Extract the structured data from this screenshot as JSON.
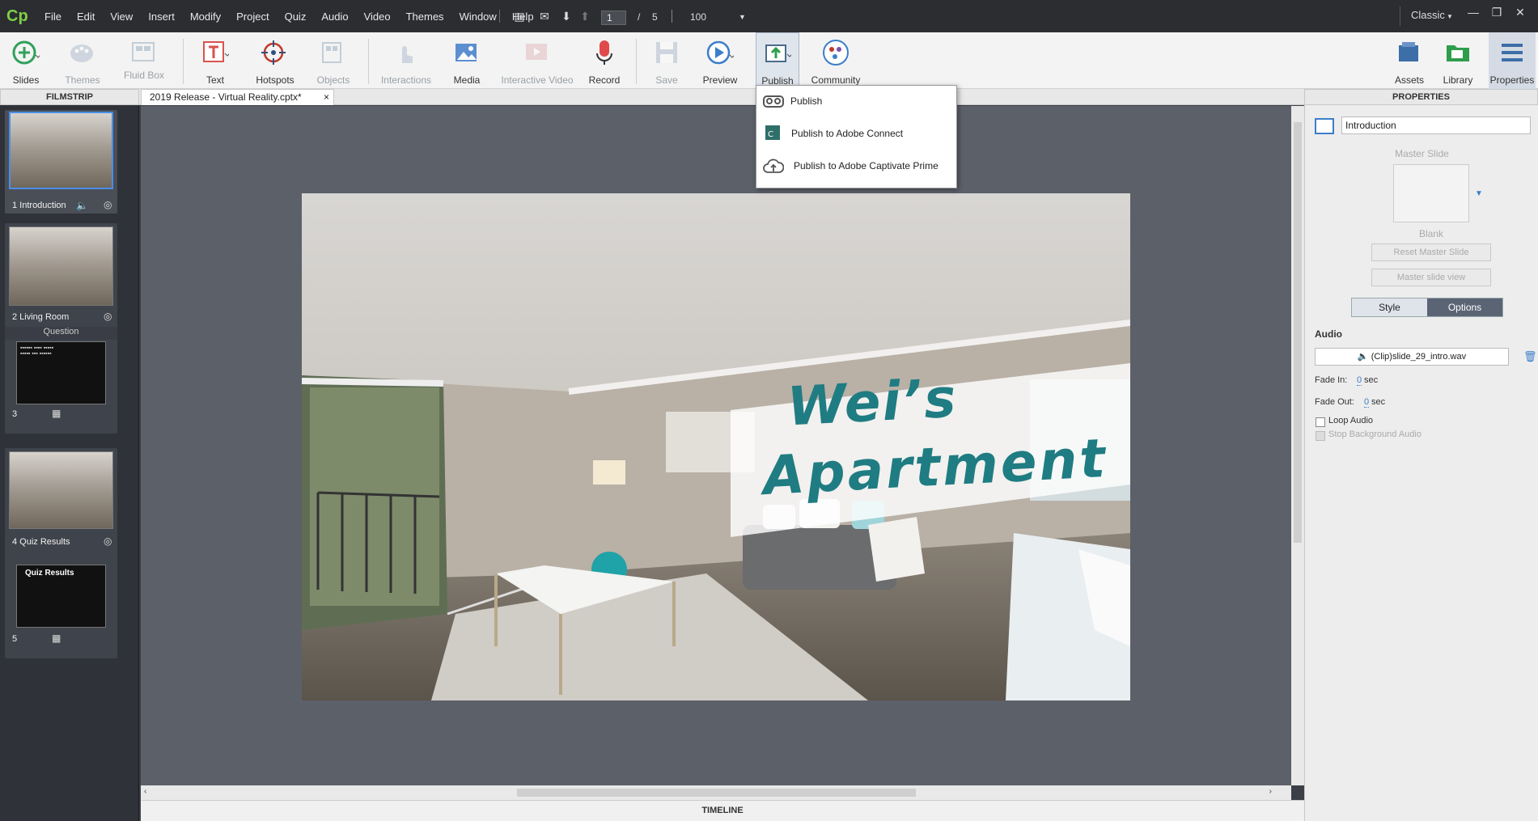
{
  "app": {
    "logo": "Cp"
  },
  "menubar": {
    "items": [
      "File",
      "Edit",
      "View",
      "Insert",
      "Modify",
      "Project",
      "Quiz",
      "Audio",
      "Video",
      "Themes",
      "Window",
      "Help"
    ],
    "current_slide": "1",
    "slide_separator": "/",
    "total_slides": "5",
    "zoom": "100",
    "workspace": "Classic"
  },
  "toolbar": {
    "slides": "Slides",
    "themes": "Themes",
    "fluid_box": "Fluid Box",
    "text": "Text",
    "hotspots": "Hotspots",
    "objects": "Objects",
    "interactions": "Interactions",
    "media": "Media",
    "interactive_video": "Interactive Video",
    "record": "Record",
    "save": "Save",
    "preview": "Preview",
    "publish": "Publish",
    "community": "Community",
    "assets": "Assets",
    "library": "Library",
    "properties": "Properties"
  },
  "publish_menu": {
    "items": [
      "Publish",
      "Publish to Adobe Connect",
      "Publish to Adobe Captivate Prime"
    ]
  },
  "filmstrip": {
    "header": "FILMSTRIP",
    "slides": [
      {
        "label": "1 Introduction"
      },
      {
        "label": "2 Living Room"
      },
      {
        "group": "Question",
        "label": "3",
        "title": "Quiz Results"
      },
      {
        "label": "4 Quiz Results"
      },
      {
        "label": "5",
        "title": "Quiz Results"
      }
    ]
  },
  "document": {
    "tab": "2019 Release - Virtual Reality.cptx*",
    "close": "×"
  },
  "slide": {
    "title_line1": "Wei’s",
    "title_line2": "Apartment"
  },
  "timeline": {
    "label": "TIMELINE"
  },
  "properties": {
    "header": "PROPERTIES",
    "name": "Introduction",
    "master_slide_label": "Master Slide",
    "master_slide_value": "Blank",
    "reset_master": "Reset Master Slide",
    "master_view": "Master slide view",
    "tabs": [
      "Style",
      "Options"
    ],
    "audio_section": "Audio",
    "audio_file": "(Clip)slide_29_intro.wav",
    "fade_in_label": "Fade In:",
    "fade_in_value": "0",
    "fade_out_label": "Fade Out:",
    "fade_out_value": "0",
    "sec": "sec",
    "loop_audio": "Loop Audio",
    "stop_bg_audio": "Stop Background Audio"
  },
  "colors": {
    "accent_green": "#7fd046",
    "selection_blue": "#4a8fe7",
    "slide_text_teal": "#1f7c82"
  }
}
